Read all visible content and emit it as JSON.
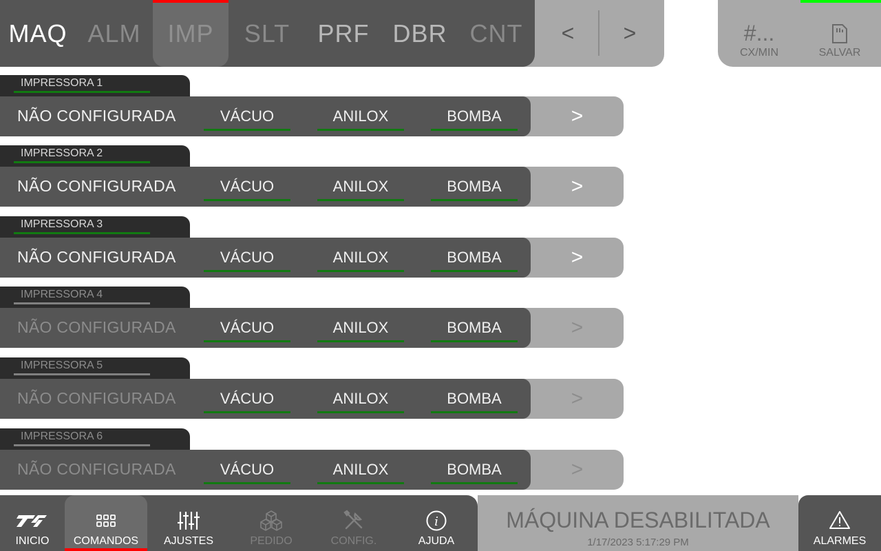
{
  "tabs": [
    {
      "label": "MAQ",
      "state": "active"
    },
    {
      "label": "ALM",
      "state": "inactive"
    },
    {
      "label": "IMP",
      "state": "selected"
    },
    {
      "label": "SLT",
      "state": "inactive"
    },
    {
      "label": "PRF",
      "state": "inactive-light"
    },
    {
      "label": "DBR",
      "state": "inactive-light"
    },
    {
      "label": "CNT",
      "state": "inactive"
    }
  ],
  "nav": {
    "prev": "<",
    "next": ">"
  },
  "top_right": {
    "rate_value": "#...",
    "rate_label": "CX/MIN",
    "save_label": "SALVAR"
  },
  "printers": [
    {
      "name": "IMPRESSORA 1",
      "status": "NÃO CONFIGURADA",
      "vacuum": "VÁCUO",
      "anilox": "ANILOX",
      "pump": "BOMBA",
      "go": ">",
      "enabled": true
    },
    {
      "name": "IMPRESSORA 2",
      "status": "NÃO CONFIGURADA",
      "vacuum": "VÁCUO",
      "anilox": "ANILOX",
      "pump": "BOMBA",
      "go": ">",
      "enabled": true
    },
    {
      "name": "IMPRESSORA 3",
      "status": "NÃO CONFIGURADA",
      "vacuum": "VÁCUO",
      "anilox": "ANILOX",
      "pump": "BOMBA",
      "go": ">",
      "enabled": true
    },
    {
      "name": "IMPRESSORA 4",
      "status": "NÃO CONFIGURADA",
      "vacuum": "VÁCUO",
      "anilox": "ANILOX",
      "pump": "BOMBA",
      "go": ">",
      "enabled": false
    },
    {
      "name": "IMPRESSORA 5",
      "status": "NÃO CONFIGURADA",
      "vacuum": "VÁCUO",
      "anilox": "ANILOX",
      "pump": "BOMBA",
      "go": ">",
      "enabled": false
    },
    {
      "name": "IMPRESSORA 6",
      "status": "NÃO CONFIGURADA",
      "vacuum": "VÁCUO",
      "anilox": "ANILOX",
      "pump": "BOMBA",
      "go": ">",
      "enabled": false
    }
  ],
  "bottom_nav": [
    {
      "label": "INICIO",
      "icon": "logo-icon",
      "enabled": true,
      "selected": false
    },
    {
      "label": "COMANDOS",
      "icon": "grid-icon",
      "enabled": true,
      "selected": true
    },
    {
      "label": "AJUSTES",
      "icon": "sliders-icon",
      "enabled": true,
      "selected": false
    },
    {
      "label": "PEDIDO",
      "icon": "boxes-icon",
      "enabled": false,
      "selected": false
    },
    {
      "label": "CONFIG.",
      "icon": "tools-icon",
      "enabled": false,
      "selected": false
    },
    {
      "label": "AJUDA",
      "icon": "info-icon",
      "enabled": true,
      "selected": false
    }
  ],
  "machine_status": "MÁQUINA DESABILITADA",
  "datetime": "1/17/2023 5:17:29 PM",
  "alarms_label": "ALARMES",
  "colors": {
    "dark_panel": "#555555",
    "light_panel": "#a9a9a9",
    "selected_accent": "#ff0000",
    "ok_indicator": "#117a11",
    "save_indicator": "#00ff00"
  }
}
